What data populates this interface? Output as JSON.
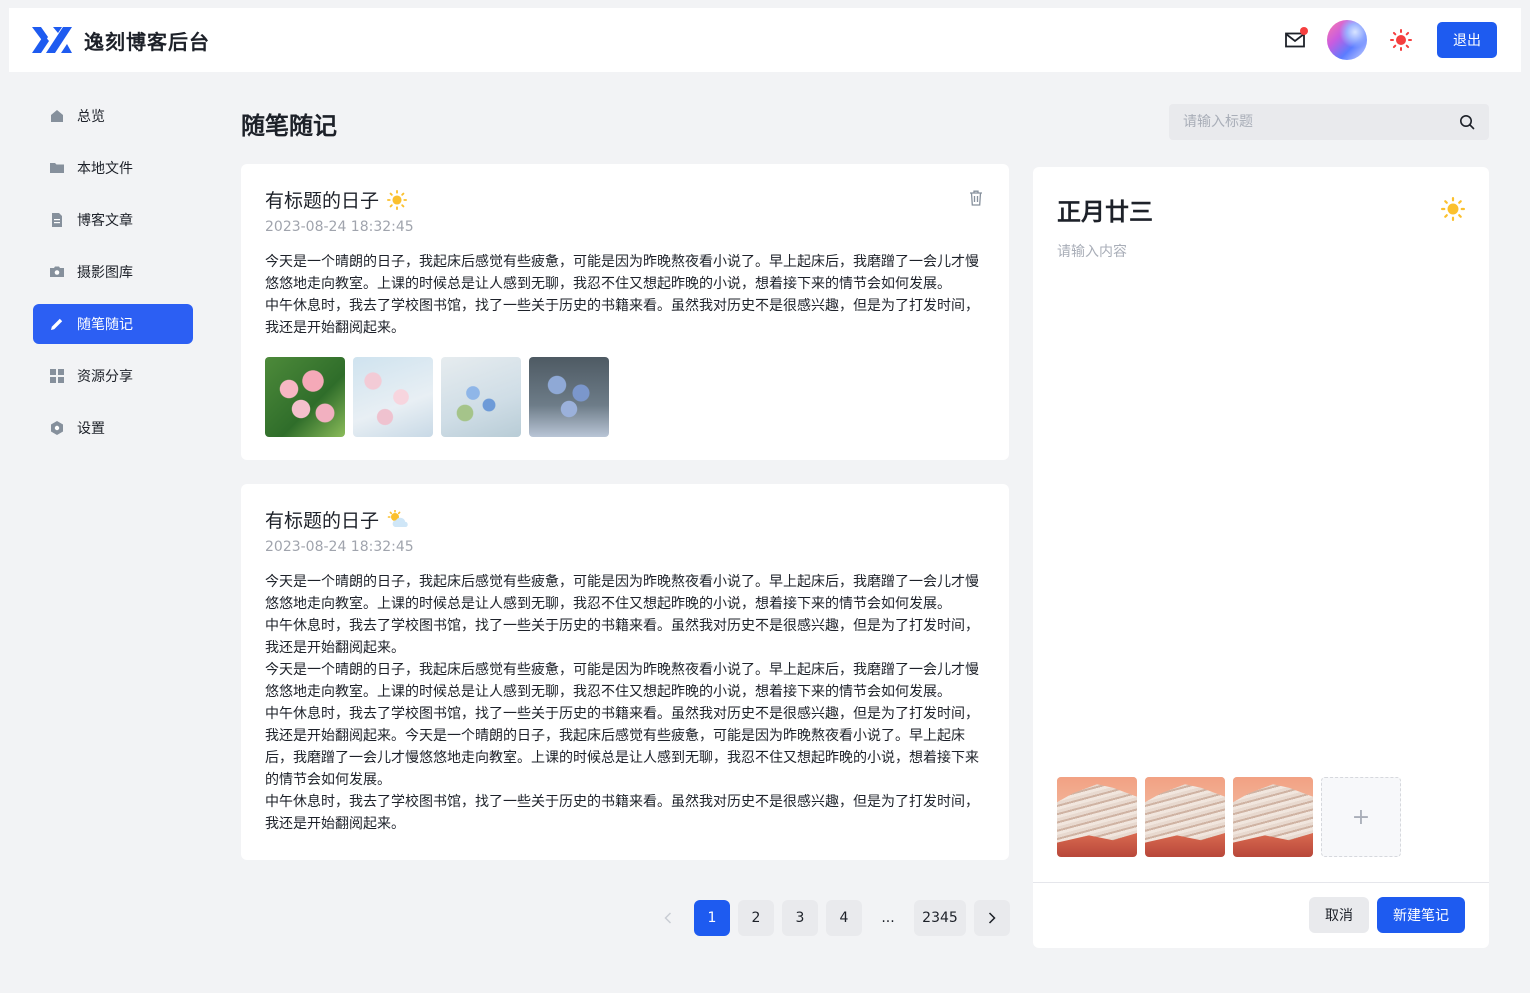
{
  "app": {
    "title": "逸刻博客后台",
    "logout_label": "退出",
    "brand_color": "#1e5bf0"
  },
  "sidebar": {
    "items": [
      {
        "label": "总览",
        "icon": "home-icon"
      },
      {
        "label": "本地文件",
        "icon": "folder-icon"
      },
      {
        "label": "博客文章",
        "icon": "document-icon"
      },
      {
        "label": "摄影图库",
        "icon": "camera-icon"
      },
      {
        "label": "随笔随记",
        "icon": "pen-icon",
        "active": true
      },
      {
        "label": "资源分享",
        "icon": "grid-icon"
      },
      {
        "label": "设置",
        "icon": "settings-icon"
      }
    ]
  },
  "main": {
    "title": "随笔随记",
    "search_placeholder": "请输入标题"
  },
  "notes": [
    {
      "title": "有标题的日子",
      "weather": "sun-icon",
      "time": "2023-08-24 18:32:45",
      "body": "今天是一个晴朗的日子，我起床后感觉有些疲惫，可能是因为昨晚熬夜看小说了。早上起床后，我磨蹭了一会儿才慢悠悠地走向教室。上课的时候总是让人感到无聊，我忍不住又想起昨晚的小说，想着接下来的情节会如何发展。\n中午休息时，我去了学校图书馆，找了一些关于历史的书籍来看。虽然我对历史不是很感兴趣，但是为了打发时间，我还是开始翻阅起来。",
      "images": [
        "pink-blossom-photo",
        "cherry-blossom-photo",
        "blue-flowers-photo",
        "forget-me-not-photo"
      ]
    },
    {
      "title": "有标题的日子",
      "weather": "partly-cloudy-icon",
      "time": "2023-08-24 18:32:45",
      "body": "今天是一个晴朗的日子，我起床后感觉有些疲惫，可能是因为昨晚熬夜看小说了。早上起床后，我磨蹭了一会儿才慢悠悠地走向教室。上课的时候总是让人感到无聊，我忍不住又想起昨晚的小说，想着接下来的情节会如何发展。\n中午休息时，我去了学校图书馆，找了一些关于历史的书籍来看。虽然我对历史不是很感兴趣，但是为了打发时间，我还是开始翻阅起来。\n今天是一个晴朗的日子，我起床后感觉有些疲惫，可能是因为昨晚熬夜看小说了。早上起床后，我磨蹭了一会儿才慢悠悠地走向教室。上课的时候总是让人感到无聊，我忍不住又想起昨晚的小说，想着接下来的情节会如何发展。\n中午休息时，我去了学校图书馆，找了一些关于历史的书籍来看。虽然我对历史不是很感兴趣，但是为了打发时间，我还是开始翻阅起来。今天是一个晴朗的日子，我起床后感觉有些疲惫，可能是因为昨晚熬夜看小说了。早上起床后，我磨蹭了一会儿才慢悠悠地走向教室。上课的时候总是让人感到无聊，我忍不住又想起昨晚的小说，想着接下来的情节会如何发展。\n中午休息时，我去了学校图书馆，找了一些关于历史的书籍来看。虽然我对历史不是很感兴趣，但是为了打发时间，我还是开始翻阅起来。"
    }
  ],
  "pagination": {
    "pages": [
      "1",
      "2",
      "3",
      "4",
      "...",
      "2345"
    ],
    "current": "1"
  },
  "editor": {
    "title": "正月廿三",
    "weather": "sun-icon",
    "content_placeholder": "请输入内容",
    "images": [
      "rainbow-mountain-photo",
      "rainbow-mountain-photo",
      "rainbow-mountain-photo"
    ],
    "add_label": "+",
    "cancel_label": "取消",
    "save_label": "新建笔记"
  }
}
